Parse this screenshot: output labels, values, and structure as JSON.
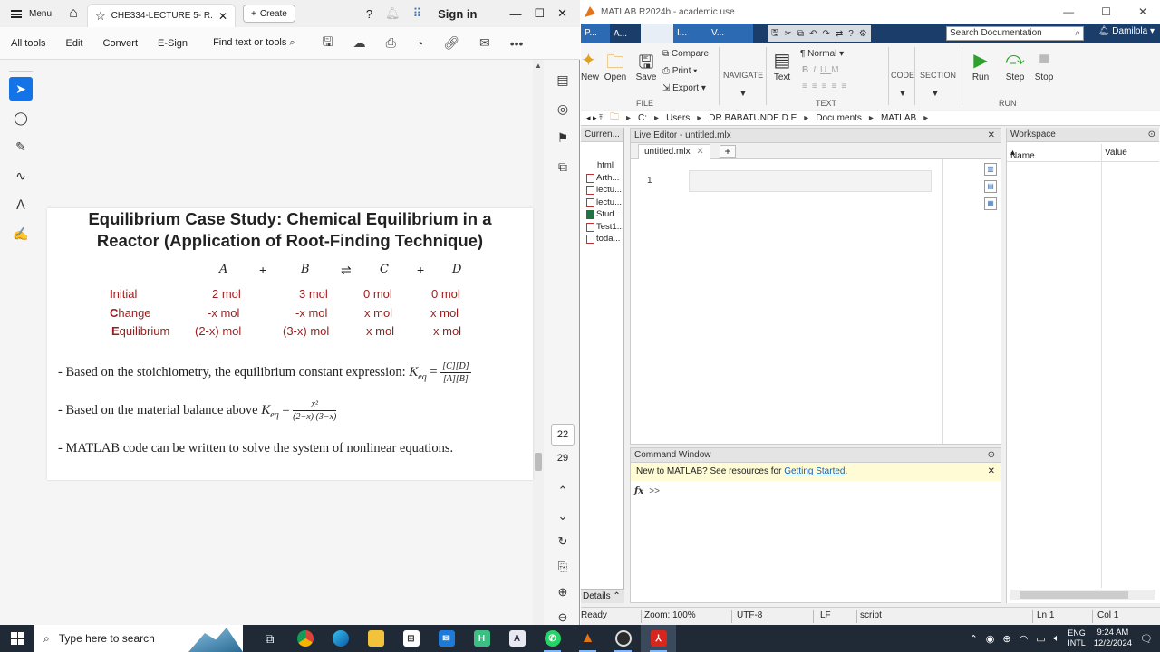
{
  "acrobat": {
    "menu_label": "Menu",
    "tab_title": "CHE334-LECTURE 5- R...",
    "create_label": "Create",
    "sign_in": "Sign in",
    "toolbar": {
      "all_tools": "All tools",
      "edit": "Edit",
      "convert": "Convert",
      "esign": "E-Sign",
      "find": "Find text or tools"
    },
    "page": {
      "title_line1": "Equilibrium Case Study: Chemical Equilibrium in a",
      "title_line2": "Reactor (Application of Root-Finding Technique)",
      "species": [
        "A",
        "B",
        "C",
        "D"
      ],
      "ops": [
        "+",
        "⇌",
        "+"
      ],
      "rows": [
        {
          "first": "I",
          "rest": "nitial",
          "a": "2 mol",
          "b": "3 mol",
          "c": "0 mol",
          "d": "0 mol"
        },
        {
          "first": "C",
          "rest": "hange",
          "a": "-x mol",
          "b": "-x mol",
          "c": "x mol",
          "d": "x mol"
        },
        {
          "first": "E",
          "rest": "quilibrium",
          "a": "(2-x) mol",
          "b": "(3-x) mol",
          "c": "x mol",
          "d": "x mol"
        }
      ],
      "bullet1": "-  Based on the stoichiometry, the equilibrium constant expression:",
      "bullet1_num": "[C][D]",
      "bullet1_den": "[A][B]",
      "bullet2": "-  Based on the material balance above",
      "bullet2_num": "x²",
      "bullet2_den": "(2−x) (3−x)",
      "bullet3": "-  MATLAB code can be written  to solve the system of nonlinear equations.",
      "k_symbol": "K",
      "k_sub": "eq"
    },
    "current_page": "22",
    "total_pages": "29"
  },
  "matlab": {
    "window_title": "MATLAB R2024b - academic use",
    "tabs": [
      "P...",
      "A...",
      "",
      "I...",
      "V..."
    ],
    "search_placeholder": "Search Documentation",
    "user": "Damilola",
    "ribbon": {
      "new": "New",
      "open": "Open",
      "save": "Save",
      "compare": "Compare",
      "print": "Print",
      "export": "Export",
      "navigate": "NAVIGATE",
      "text": "Text",
      "normal": "Normal",
      "code": "CODE",
      "section": "SECTION",
      "run": "Run",
      "step": "Step",
      "stop": "Stop",
      "group_file": "FILE",
      "group_text": "TEXT",
      "group_run": "RUN"
    },
    "address": [
      "C:",
      "Users",
      "DR BABATUNDE D E",
      "Documents",
      "MATLAB"
    ],
    "current_folder_title": "Curren...",
    "files": [
      "html",
      "Arth...",
      "lectu...",
      "lectu...",
      "Stud...",
      "Test1...",
      "toda..."
    ],
    "details": "Details",
    "editor_title": "Live Editor - untitled.mlx",
    "editor_tab": "untitled.mlx",
    "line_number": "1",
    "command_title": "Command Window",
    "command_banner": "New to MATLAB? See resources for",
    "command_link": "Getting Started",
    "command_prompt": ">>",
    "workspace_title": "Workspace",
    "ws_name": "Name",
    "ws_value": "Value",
    "status": {
      "ready": "Ready",
      "zoom": "Zoom: 100%",
      "encoding": "UTF-8",
      "eol": "LF",
      "mode": "script",
      "ln": "Ln  1",
      "col": "Col  1"
    }
  },
  "taskbar": {
    "search_placeholder": "Type here to search",
    "lang1": "ENG",
    "lang2": "INTL",
    "time": "9:24 AM",
    "date": "12/2/2024"
  }
}
